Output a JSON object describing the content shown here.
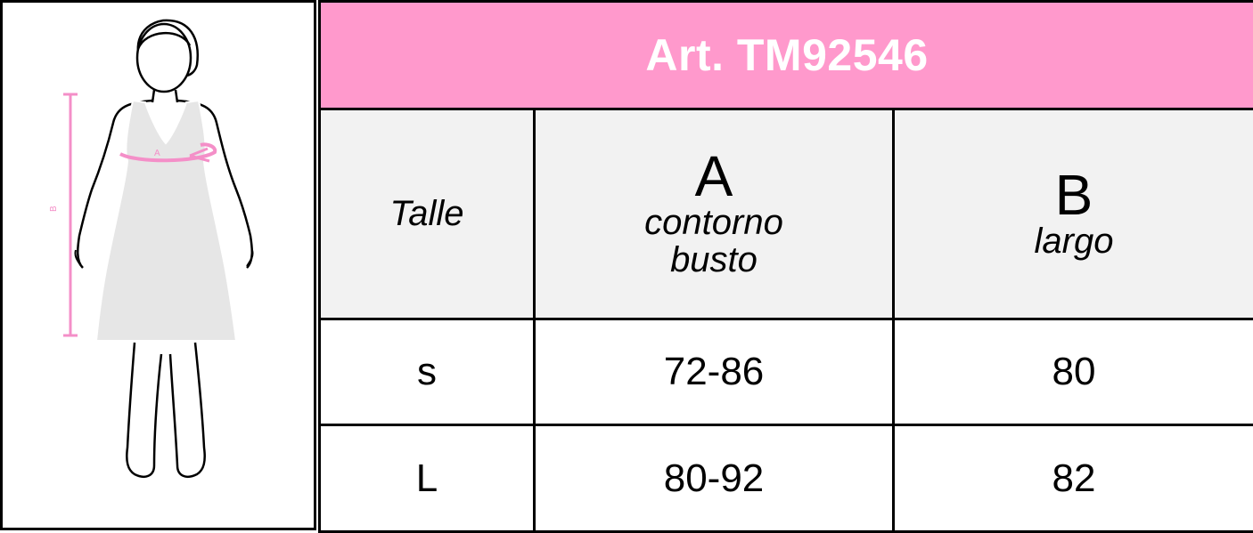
{
  "title": "Art. TM92546",
  "colors": {
    "header_bg": "#ff99cc",
    "header_text": "#ffffff",
    "subheader_bg": "#f2f2f2",
    "measure_line": "#f48fc8"
  },
  "figure": {
    "label_a": "A",
    "label_b": "B"
  },
  "table": {
    "size_header": "Talle",
    "columns": [
      {
        "letter": "A",
        "desc_line1": "contorno",
        "desc_line2": "busto"
      },
      {
        "letter": "B",
        "desc_line1": "largo",
        "desc_line2": ""
      }
    ],
    "rows": [
      {
        "size": "s",
        "a": "72-86",
        "b": "80"
      },
      {
        "size": "L",
        "a": "80-92",
        "b": "82"
      }
    ]
  }
}
